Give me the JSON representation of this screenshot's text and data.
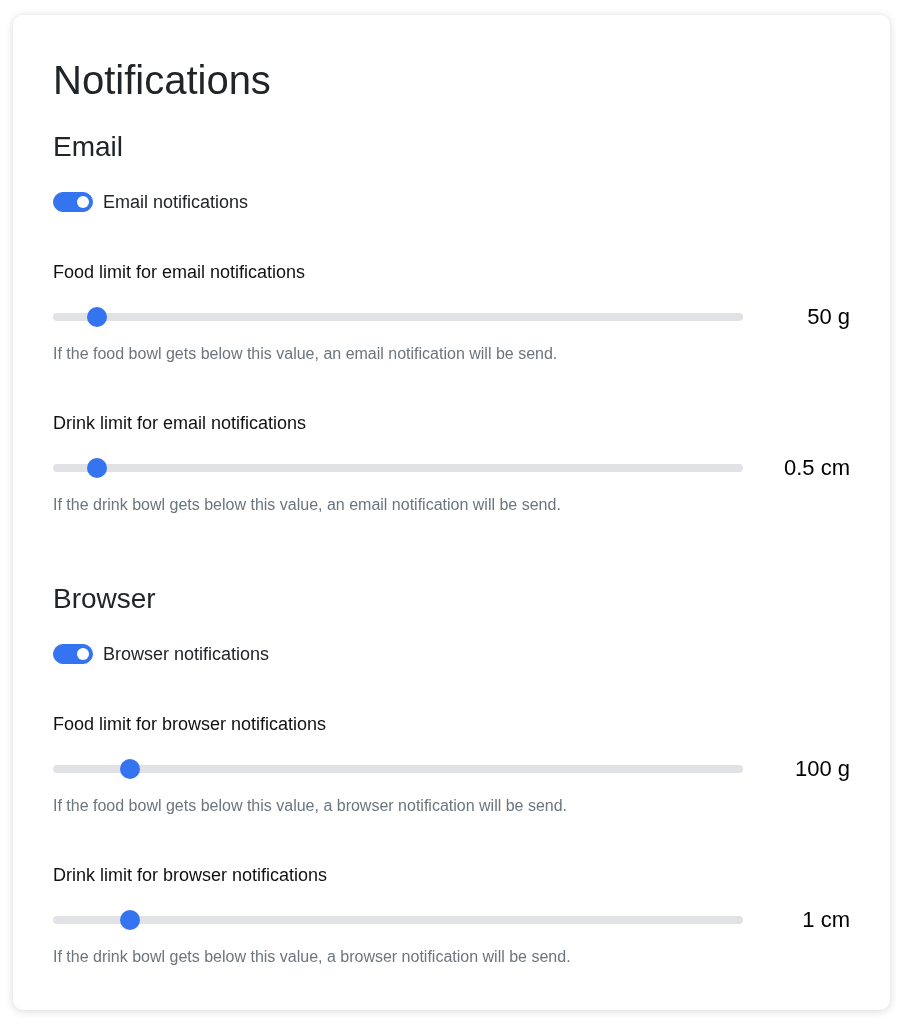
{
  "title": "Notifications",
  "sections": [
    {
      "heading": "Email",
      "toggle": {
        "label": "Email notifications",
        "on": true
      },
      "limits": [
        {
          "label": "Food limit for email notifications",
          "level": 0.05,
          "reading": "50 g",
          "help": "If the food bowl gets below this value, an email notification will be send."
        },
        {
          "label": "Drink limit for email notifications",
          "level": 0.05,
          "reading": "0.5 cm",
          "help": "If the drink bowl gets below this value, an email notification will be send."
        }
      ]
    },
    {
      "heading": "Browser",
      "toggle": {
        "label": "Browser notifications",
        "on": true
      },
      "limits": [
        {
          "label": "Food limit for browser notifications",
          "level": 0.1,
          "reading": "100 g",
          "help": "If the food bowl gets below this value, a browser notification will be send."
        },
        {
          "label": "Drink limit for browser notifications",
          "level": 0.1,
          "reading": "1 cm",
          "help": "If the drink bowl gets below this value, a browser notification will be send."
        }
      ]
    }
  ]
}
